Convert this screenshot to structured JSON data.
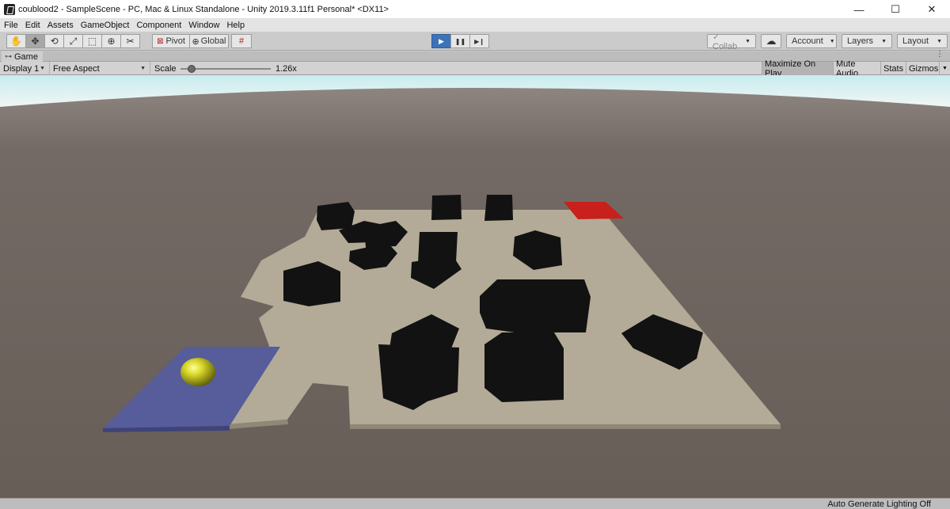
{
  "window": {
    "title": "coublood2 - SampleScene - PC, Mac & Linux Standalone - Unity 2019.3.11f1 Personal* <DX11>",
    "minimize_glyph": "—",
    "maximize_glyph": "☐",
    "close_glyph": "✕"
  },
  "menu": [
    "File",
    "Edit",
    "Assets",
    "GameObject",
    "Component",
    "Window",
    "Help"
  ],
  "toolbar": {
    "tools": [
      {
        "name": "hand-tool-icon",
        "glyph": "✋"
      },
      {
        "name": "move-tool-icon",
        "glyph": "✥"
      },
      {
        "name": "rotate-tool-icon",
        "glyph": "⟲"
      },
      {
        "name": "scale-tool-icon",
        "glyph": "⤢"
      },
      {
        "name": "rect-tool-icon",
        "glyph": "⬚"
      },
      {
        "name": "transform-tool-icon",
        "glyph": "⊕"
      },
      {
        "name": "custom-tool-icon",
        "glyph": "✂"
      }
    ],
    "pivot_label": "Pivot",
    "global_label": "Global",
    "play_glyph": "▶",
    "pause_glyph": "❚❚",
    "step_glyph": "▶❙",
    "collab_label": "Collab",
    "cloud_glyph": "☁",
    "account_label": "Account",
    "layers_label": "Layers",
    "layout_label": "Layout"
  },
  "game_tab": {
    "icon": "gamepad-icon",
    "label": "Game",
    "menu_glyph": "⋮"
  },
  "game_toolbar": {
    "display": "Display 1",
    "aspect": "Free Aspect",
    "scale_label": "Scale",
    "scale_value": "1.26x",
    "scale_fraction": 0.12,
    "maximize_on_play": "Maximize On Play",
    "mute_audio": "Mute Audio",
    "stats": "Stats",
    "gizmos": "Gizmos"
  },
  "status": {
    "text": "Auto Generate Lighting Off"
  },
  "scene_colors": {
    "sky": "#d8eef0",
    "ground": "#6f6661",
    "floor": "#b3ab97",
    "start_pad": "#575c9a",
    "goal_pad": "#c8201c",
    "player_ball": "#c9c91e",
    "obstacles": "#121212"
  }
}
